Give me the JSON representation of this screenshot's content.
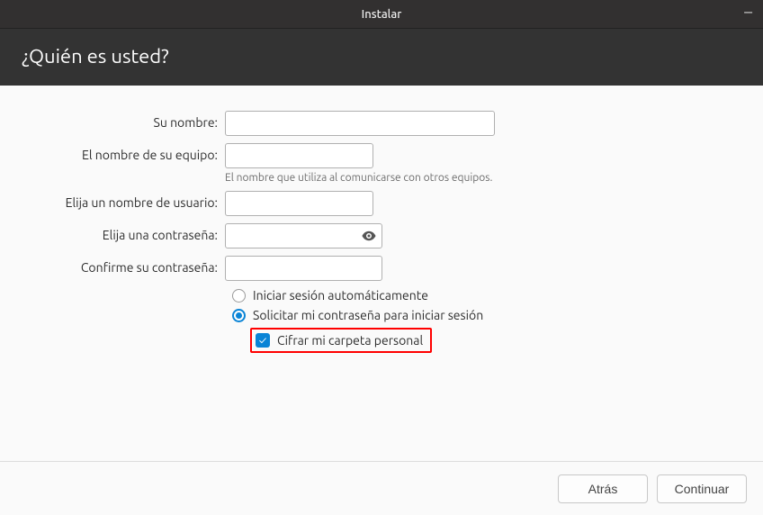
{
  "window": {
    "title": "Instalar"
  },
  "header": {
    "title": "¿Quién es usted?"
  },
  "form": {
    "name_label": "Su nombre:",
    "name_value": "",
    "hostname_label": "El nombre de su equipo:",
    "hostname_value": "",
    "hostname_hint": "El nombre que utiliza al comunicarse con otros equipos.",
    "username_label": "Elija un nombre de usuario:",
    "username_value": "",
    "password_label": "Elija una contraseña:",
    "password_value": "",
    "confirm_label": "Confirme su contraseña:",
    "confirm_value": ""
  },
  "options": {
    "auto_login": "Iniciar sesión automáticamente",
    "require_password": "Solicitar mi contraseña para iniciar sesión",
    "encrypt_home": "Cifrar mi carpeta personal"
  },
  "footer": {
    "back": "Atrás",
    "continue": "Continuar"
  }
}
